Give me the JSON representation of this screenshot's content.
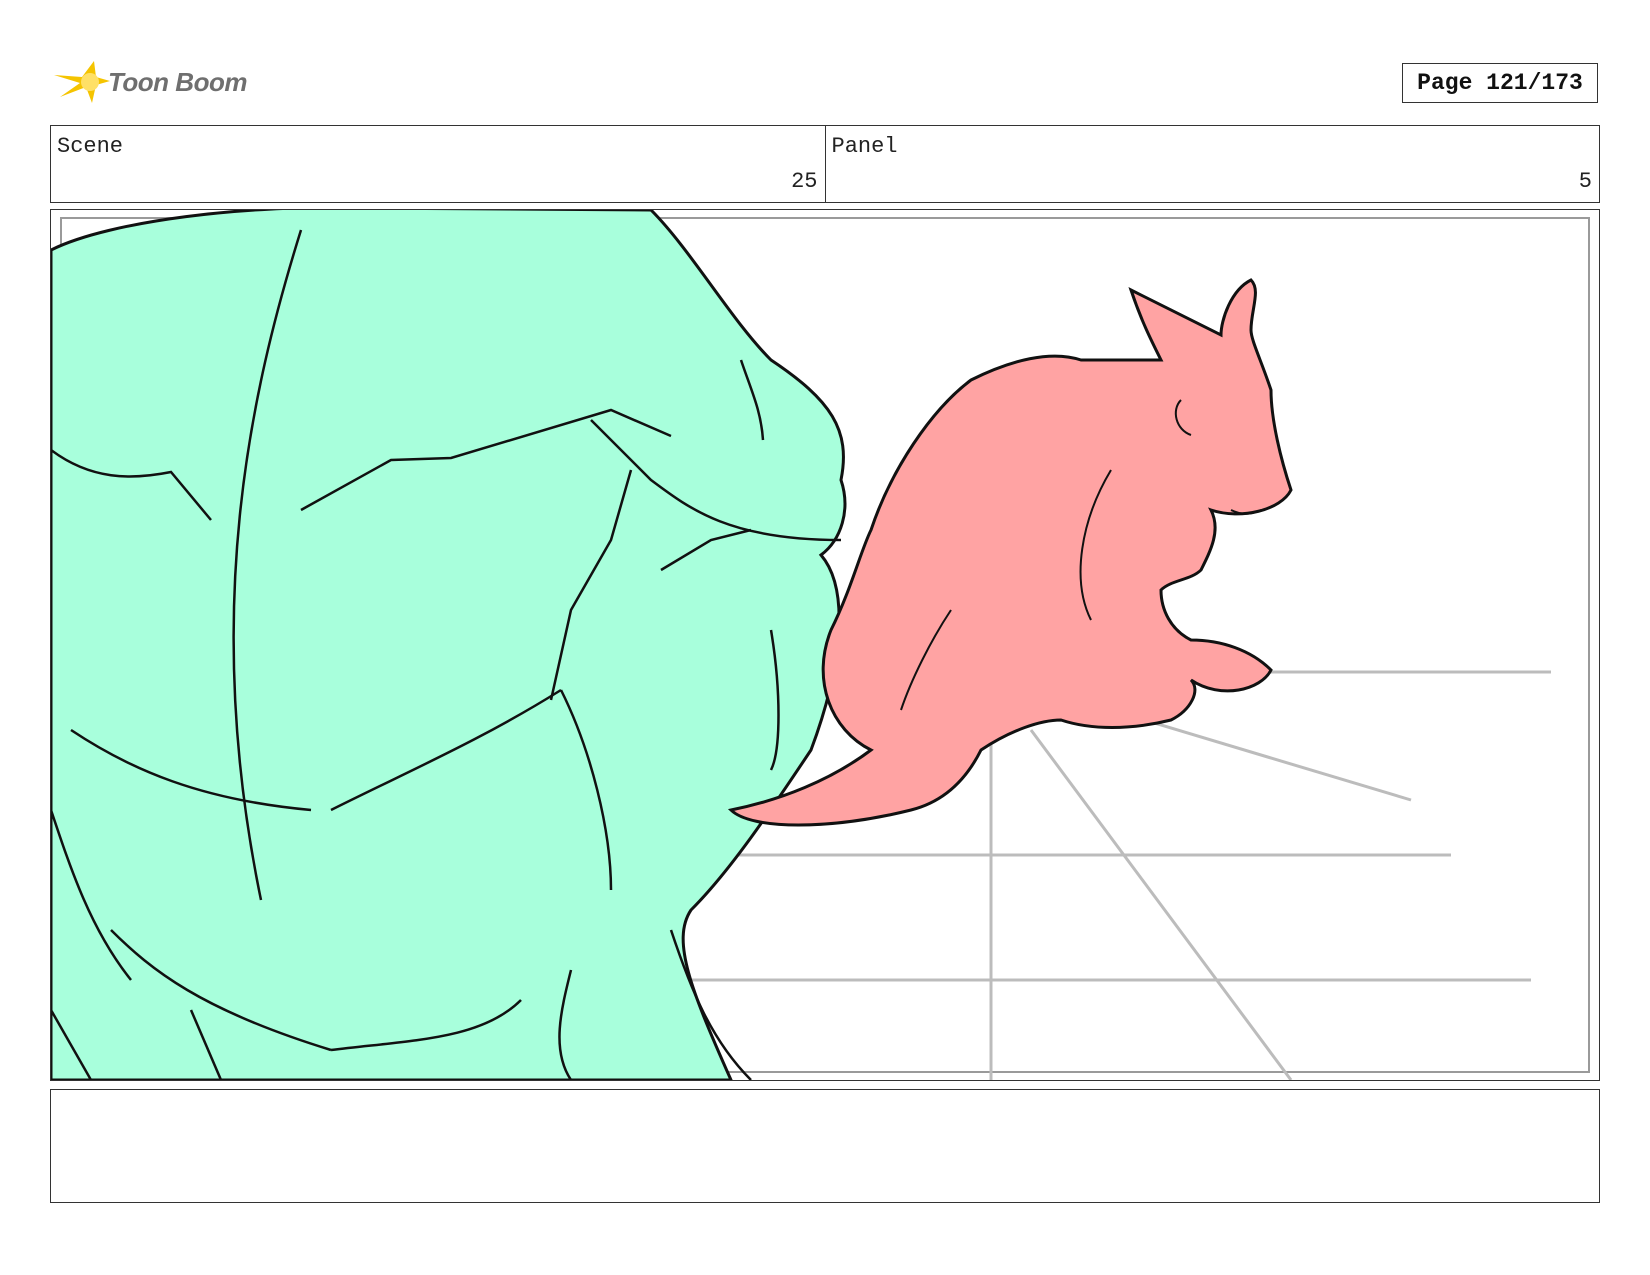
{
  "header": {
    "logo_text": "Toon Boom",
    "page_label": "Page 121/173"
  },
  "info": {
    "scene_label": "Scene",
    "scene_value": "25",
    "panel_label": "Panel",
    "panel_value": "5"
  },
  "colors": {
    "green_character": "#a8ffdc",
    "pink_creature": "#ffa3a3",
    "floor_lines": "#bcbcbc",
    "logo_star": "#f5c400"
  },
  "notes": {
    "text": ""
  }
}
